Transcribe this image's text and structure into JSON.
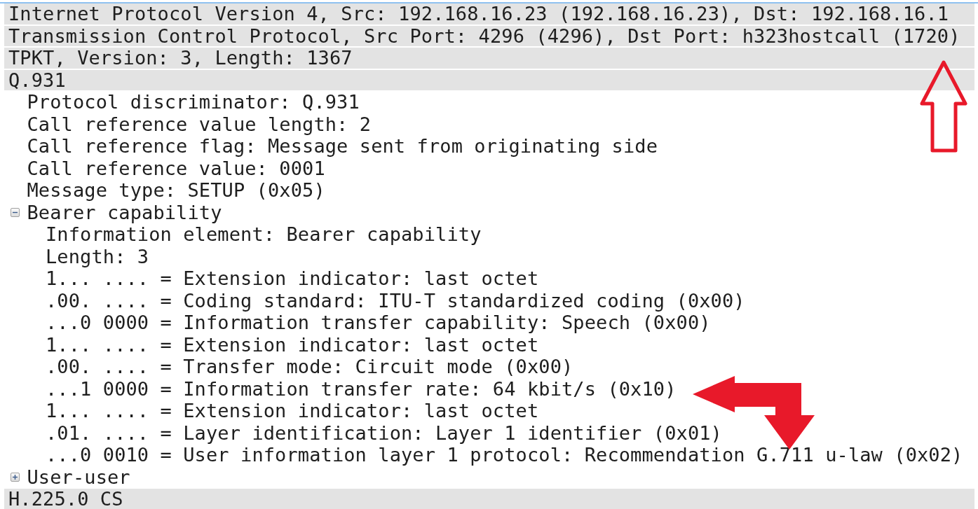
{
  "tree": [
    {
      "label": "Internet Protocol Version 4, Src: 192.168.16.23 (192.168.16.23), Dst: 192.168.16.1"
    },
    {
      "label": "Transmission Control Protocol, Src Port: 4296 (4296), Dst Port: h323hostcall (1720)"
    },
    {
      "label": "TPKT, Version: 3, Length: 1367"
    },
    {
      "label": "Q.931",
      "children": [
        {
          "label": "Protocol discriminator: Q.931"
        },
        {
          "label": "Call reference value length: 2"
        },
        {
          "label": "Call reference flag: Message sent from originating side"
        },
        {
          "label": "Call reference value: 0001"
        },
        {
          "label": "Message type: SETUP (0x05)"
        },
        {
          "label": "Bearer capability",
          "expanded": true,
          "children": [
            {
              "label": "Information element: Bearer capability"
            },
            {
              "label": "Length: 3"
            },
            {
              "label": "1... .... = Extension indicator: last octet"
            },
            {
              "label": ".00. .... = Coding standard: ITU-T standardized coding (0x00)"
            },
            {
              "label": "...0 0000 = Information transfer capability: Speech (0x00)"
            },
            {
              "label": "1... .... = Extension indicator: last octet"
            },
            {
              "label": ".00. .... = Transfer mode: Circuit mode (0x00)"
            },
            {
              "label": "...1 0000 = Information transfer rate: 64 kbit/s (0x10)"
            },
            {
              "label": "1... .... = Extension indicator: last octet"
            },
            {
              "label": ".01. .... = Layer identification: Layer 1 identifier (0x01)"
            },
            {
              "label": "...0 0010 = User information layer 1 protocol: Recommendation G.711 u-law (0x02)"
            }
          ]
        },
        {
          "label": "User-user",
          "expanded": false
        }
      ]
    },
    {
      "label": "H.225.0 CS"
    }
  ]
}
